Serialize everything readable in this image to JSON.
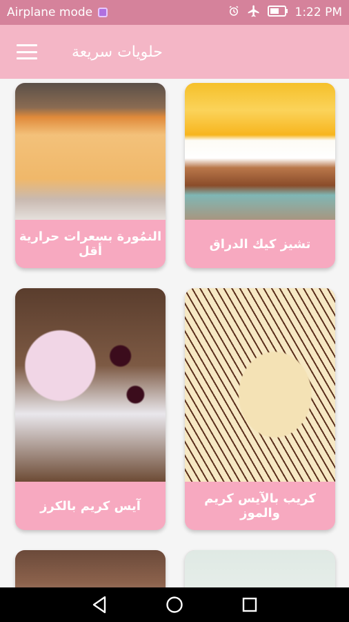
{
  "status_bar": {
    "mode_text": "Airplane mode",
    "time": "1:22 PM"
  },
  "app_bar": {
    "title": "حلويات سريعة",
    "menu_icon": "hamburger-menu-icon"
  },
  "recipes": [
    {
      "label": "النمُورة بسعرات حرارية أقل",
      "image": "basbousa"
    },
    {
      "label": "تشيز كيك الدراق",
      "image": "peach-cheesecake"
    },
    {
      "label": "آيس كريم بالكرز",
      "image": "cherry-ice-cream"
    },
    {
      "label": "كريب بالآيس كريم والموز",
      "image": "banana-ice-cream-crepe"
    },
    {
      "label": "",
      "image": "brownie"
    },
    {
      "label": "",
      "image": "light-dessert"
    }
  ],
  "colors": {
    "status_bar": "#d5829b",
    "app_bar": "#f4b6c6",
    "card_label_bg": "#f7a9c0"
  }
}
